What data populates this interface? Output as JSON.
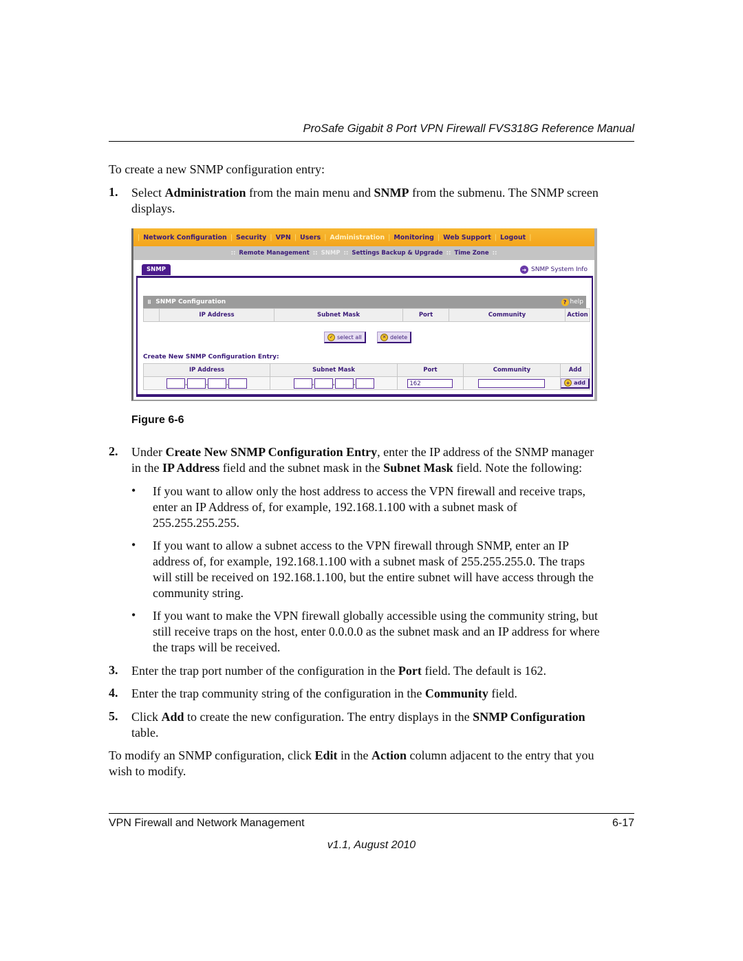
{
  "header": {
    "title": "ProSafe Gigabit 8 Port VPN Firewall FVS318G Reference Manual"
  },
  "intro": "To create a new SNMP configuration entry:",
  "steps": [
    {
      "num": "1.",
      "parts": [
        "Select ",
        "Administration",
        " from the main menu and ",
        "SNMP",
        " from the submenu. The SNMP screen",
        "displays."
      ]
    },
    {
      "num": "2.",
      "parts": [
        "Under ",
        "Create New SNMP Configuration Entry",
        ", enter the IP address of the SNMP manager",
        "in the ",
        "IP Address",
        " field and the subnet mask in the ",
        "Subnet Mask",
        " field. Note the following:"
      ]
    },
    {
      "num": "3.",
      "parts": [
        "Enter the trap port number of the configuration in the ",
        "Port",
        " field. The default is 162."
      ]
    },
    {
      "num": "4.",
      "parts": [
        "Enter the trap community string of the configuration in the ",
        "Community",
        " field."
      ]
    },
    {
      "num": "5.",
      "parts": [
        "Click ",
        "Add",
        " to create the new configuration. The entry displays in the ",
        "SNMP Configuration",
        "table."
      ]
    }
  ],
  "bullets": [
    [
      "If you want to allow only the host address to access the VPN firewall and receive traps,",
      "enter an IP Address of, for example, 192.168.1.100 with a subnet mask of",
      "255.255.255.255."
    ],
    [
      "If you want to allow a subnet access to the VPN firewall through SNMP, enter an IP",
      "address of, for example, 192.168.1.100 with a subnet mask of 255.255.255.0. The traps",
      "will still be received on 192.168.1.100, but the entire subnet will have access through the",
      "community string."
    ],
    [
      "If you want to make the VPN firewall globally accessible using the community string, but",
      "still receive traps on the host, enter 0.0.0.0 as the subnet mask and an IP address for where",
      "the traps will be received."
    ]
  ],
  "closing": {
    "parts": [
      "To modify an SNMP configuration, click ",
      "Edit",
      " in the ",
      "Action",
      " column adjacent to the entry that you",
      "wish to modify."
    ]
  },
  "figure_caption": "Figure 6-6",
  "footer": {
    "section": "VPN Firewall and Network Management",
    "page": "6-17",
    "version": "v1.1, August 2010"
  },
  "ui": {
    "main_menu": [
      "Network Configuration",
      "Security",
      "VPN",
      "Users",
      "Administration",
      "Monitoring",
      "Web Support",
      "Logout"
    ],
    "main_menu_active": "Administration",
    "sub_menu": [
      "Remote Management",
      "SNMP",
      "Settings Backup & Upgrade",
      "Time Zone"
    ],
    "sub_menu_active": "SNMP",
    "tab": "SNMP",
    "system_info_link": "SNMP System Info",
    "section_title": "SNMP Configuration",
    "help_label": "help",
    "table_headers": [
      "",
      "IP Address",
      "Subnet Mask",
      "Port",
      "Community",
      "Action"
    ],
    "select_all_label": "select all",
    "delete_label": "delete",
    "create_title": "Create New SNMP Configuration Entry:",
    "create_headers": [
      "IP Address",
      "Subnet Mask",
      "Port",
      "Community",
      "Add"
    ],
    "port_value": "162",
    "community_value": "",
    "add_label": "add",
    "colors": {
      "nav_bg": "#f4a51c",
      "accent": "#3a1678",
      "section_bg": "#9b9b9b"
    }
  }
}
